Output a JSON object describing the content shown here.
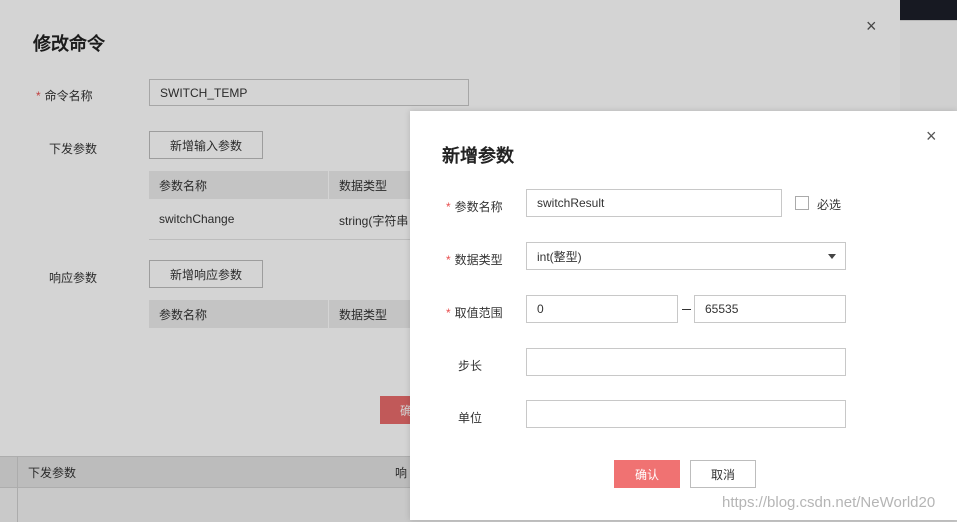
{
  "background": {
    "bottom_table_headers": [
      "下发参数",
      "响"
    ]
  },
  "edit_dialog": {
    "title": "修改命令",
    "close_glyph": "×",
    "command_name_label": "命令名称",
    "command_name_value": "SWITCH_TEMP",
    "send_params_label": "下发参数",
    "add_input_param_button": "新增输入参数",
    "send_table": {
      "headers": [
        "参数名称",
        "数据类型"
      ],
      "rows": [
        [
          "switchChange",
          "string(字符串"
        ]
      ]
    },
    "response_params_label": "响应参数",
    "add_response_param_button": "新增响应参数",
    "response_table": {
      "headers": [
        "参数名称",
        "数据类型"
      ]
    },
    "confirm_partial": "确"
  },
  "add_param_dialog": {
    "title": "新增参数",
    "close_glyph": "×",
    "param_name_label": "参数名称",
    "param_name_value": "switchResult",
    "required_checkbox_label": "必选",
    "data_type_label": "数据类型",
    "data_type_value": "int(整型)",
    "range_label": "取值范围",
    "range_min": "0",
    "range_max": "65535",
    "step_label": "步长",
    "step_value": "",
    "unit_label": "单位",
    "unit_value": "",
    "confirm_button": "确认",
    "cancel_button": "取消"
  },
  "watermark": "https://blog.csdn.net/NeWorld20",
  "colors": {
    "confirm": "#f07272",
    "required_star": "#e84e4e"
  }
}
